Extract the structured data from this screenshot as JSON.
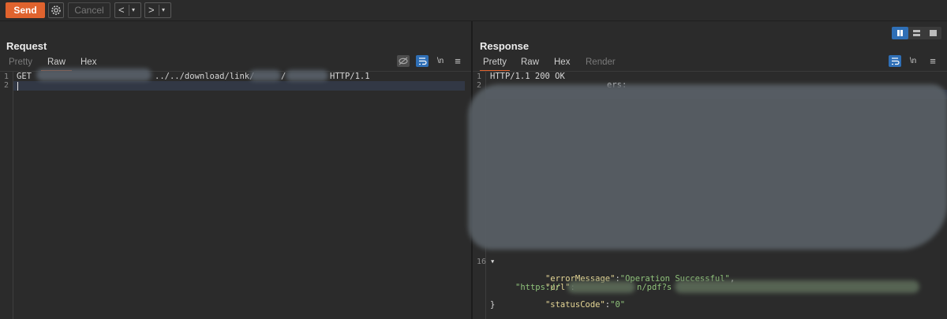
{
  "toolbar": {
    "send_label": "Send",
    "cancel_label": "Cancel",
    "back_arrow": "<",
    "forward_arrow": ">",
    "dropdown_glyph": "▾"
  },
  "request": {
    "title": "Request",
    "tabs": [
      "Pretty",
      "Raw",
      "Hex"
    ],
    "active_tab": "Raw",
    "newline_toggle": "\\n",
    "menu_glyph": "≡",
    "lines": [
      {
        "num": "1",
        "method": "GET",
        "path_mid": "../../download/link/",
        "slash": "/",
        "version": "HTTP/1.1"
      },
      {
        "num": "2"
      }
    ]
  },
  "response": {
    "title": "Response",
    "tabs": [
      "Pretty",
      "Raw",
      "Hex",
      "Render"
    ],
    "active_tab": "Pretty",
    "newline_toggle": "\\n",
    "menu_glyph": "≡",
    "status_line_num": "1",
    "status_line": "HTTP/1.1 200 OK",
    "line2_num": "2",
    "line2_fragment": "ers:",
    "body_line_num": "16",
    "json": {
      "error_key": "\"errorMessage\"",
      "error_val": "\"Operation Successful\"",
      "url_key": "\"url\"",
      "url_val_start": "\"https://",
      "url_val_mid": "n/pdf?s",
      "status_key": "\"statusCode\"",
      "status_val": "\"0\"",
      "close_brace": "}"
    }
  },
  "colors": {
    "accent": "#e0632e",
    "toggle_blue": "#2f6fb6",
    "json_key": "#e6d796",
    "json_string": "#8fc27a"
  }
}
